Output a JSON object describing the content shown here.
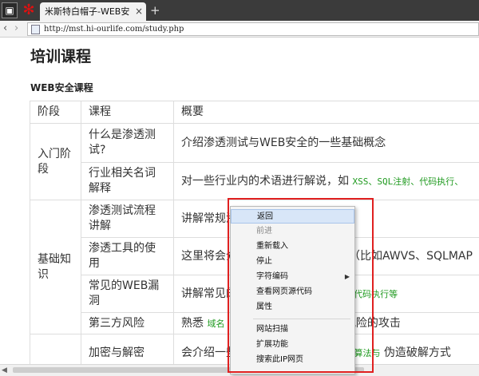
{
  "browser": {
    "tab_title": "米斯特白帽子-WEB安",
    "tab_close": "×",
    "new_tab": "+",
    "back_arrow": "‹",
    "forward_arrow": "›",
    "url": "http://mst.hi-ourlife.com/study.php"
  },
  "page": {
    "title": "培训课程",
    "section": "WEB安全课程",
    "table": {
      "headers": [
        "阶段",
        "课程",
        "概要"
      ],
      "rows": [
        {
          "stage": "入门阶段",
          "course": "什么是渗透测试?",
          "summary": "介绍渗透测试与WEB安全的一些基础概念"
        },
        {
          "stage": "",
          "course": "行业相关名词解释",
          "summary": "对一些行业内的术语进行解说，如 ",
          "summary_kw": "XSS、SQL注射、代码执行、"
        },
        {
          "stage": "基础知识",
          "course": "渗透测试流程讲解",
          "summary": "讲解常规渗透测试的整体思路"
        },
        {
          "stage": "",
          "course": "渗透工具的使用",
          "summary": "这里将会介绍渗透测试神器的使用（比如AWVS、SQLMAP"
        },
        {
          "stage": "",
          "course": "常见的WEB漏洞",
          "summary": "讲解常见的WEB漏洞",
          "summary_kw": "注入、XSS攻击、代码执行等"
        },
        {
          "stage": "",
          "course": "第三方风险",
          "summary": "熟悉",
          "summary_kw": "域名",
          "summary_tail": "对第三方风险的攻击"
        },
        {
          "stage": "",
          "course": "加密与解密",
          "summary": "会介绍一些",
          "summary_kw": "加密算法与",
          "summary_tail": "伪造破解方式"
        }
      ]
    }
  },
  "context_menu": {
    "items": [
      {
        "label": "返回",
        "state": "highlighted"
      },
      {
        "label": "前进",
        "state": "disabled"
      },
      {
        "label": "重新载入",
        "state": "normal"
      },
      {
        "label": "停止",
        "state": "normal"
      },
      {
        "label": "字符编码",
        "state": "submenu",
        "arrow": "▶"
      },
      {
        "label": "查看网页源代码",
        "state": "normal"
      },
      {
        "label": "属性",
        "state": "normal"
      },
      {
        "label": "网站扫描",
        "state": "normal"
      },
      {
        "label": "扩展功能",
        "state": "normal"
      },
      {
        "label": "搜索此IP网页",
        "state": "normal"
      }
    ]
  },
  "colors": {
    "highlight_frame": "#e02020",
    "keyword": "#1f9a1f"
  }
}
